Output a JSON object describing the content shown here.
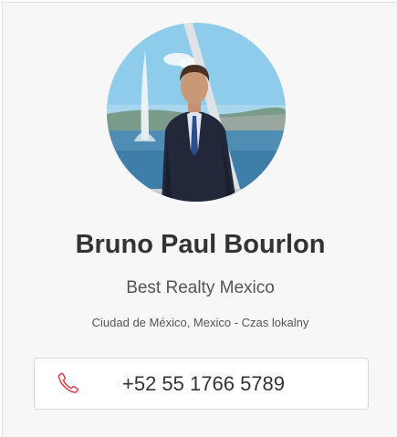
{
  "profile": {
    "name": "Bruno Paul Bourlon",
    "company": "Best Realty Mexico",
    "location": "Ciudad de México, Mexico - Czas lokalny",
    "phone": "+52 55 1766 5789"
  },
  "colors": {
    "phone_icon": "#d9363e",
    "name_text": "#333333",
    "card_background": "#f7f7f7"
  },
  "icons": {
    "phone": "phone-icon"
  }
}
